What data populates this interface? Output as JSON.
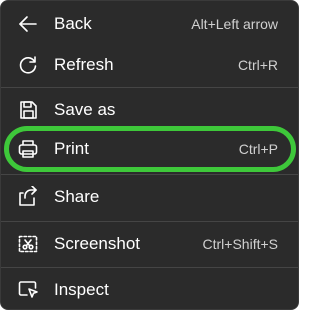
{
  "menu": {
    "items": [
      {
        "label": "Back",
        "shortcut": "Alt+Left arrow",
        "icon": "back-arrow-icon"
      },
      {
        "label": "Refresh",
        "shortcut": "Ctrl+R",
        "icon": "refresh-icon"
      },
      {
        "label": "Save as",
        "shortcut": "",
        "icon": "save-icon"
      },
      {
        "label": "Print",
        "shortcut": "Ctrl+P",
        "icon": "printer-icon"
      },
      {
        "label": "Share",
        "shortcut": "",
        "icon": "share-icon"
      },
      {
        "label": "Screenshot",
        "shortcut": "Ctrl+Shift+S",
        "icon": "screenshot-icon"
      },
      {
        "label": "Inspect",
        "shortcut": "",
        "icon": "inspect-icon"
      }
    ]
  },
  "colors": {
    "menu_background": "#2b2b2b",
    "text": "#ffffff",
    "shortcut_text": "#d0d0d0",
    "highlight_ring": "#3ec83a"
  }
}
